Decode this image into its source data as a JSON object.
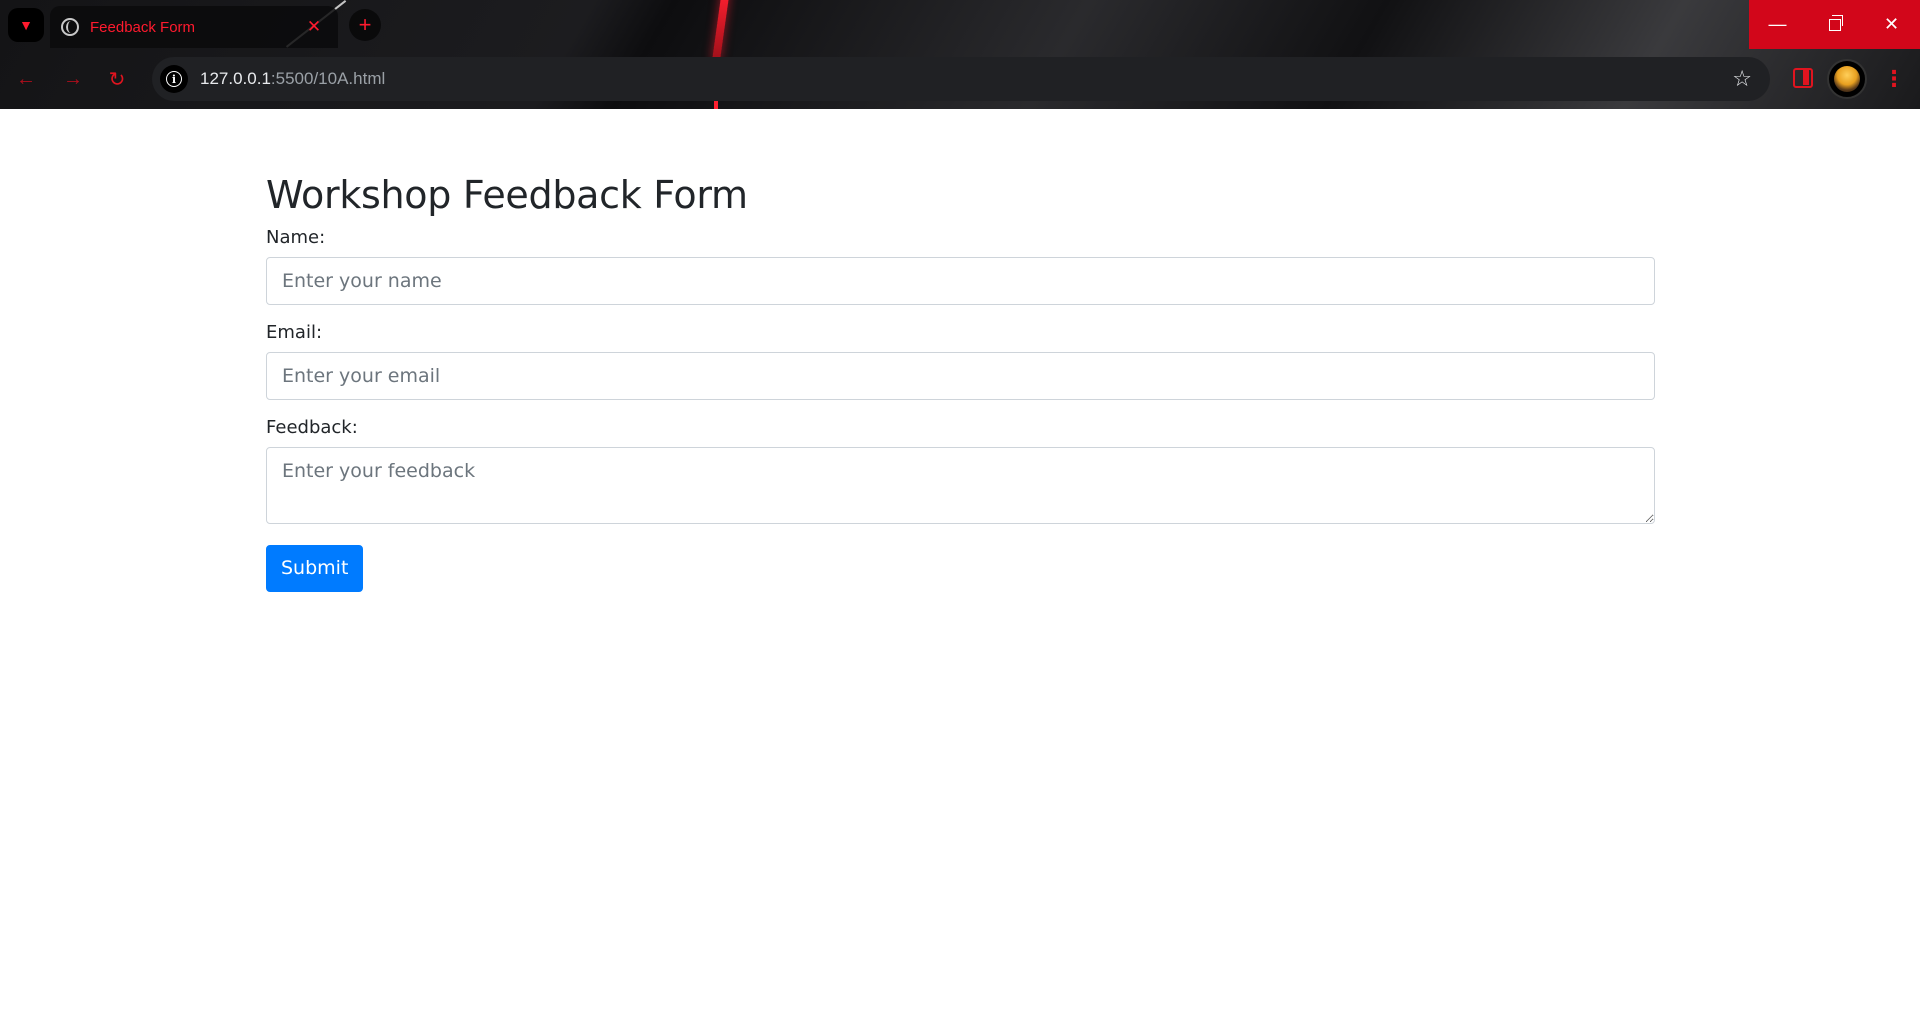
{
  "browser": {
    "tab_title": "Feedback Form",
    "new_tab_symbol": "+",
    "tab_close_symbol": "✕",
    "url_host": "127.0.0.1",
    "url_path": ":5500/10A.html",
    "window_controls": {
      "minimize_symbol": "—",
      "close_symbol": "✕"
    },
    "accent_color": "#e0141f",
    "window_control_color": "#d2061a"
  },
  "form": {
    "title": "Workshop Feedback Form",
    "name_label": "Name:",
    "name_placeholder": "Enter your name",
    "name_value": "",
    "email_label": "Email:",
    "email_placeholder": "Enter your email",
    "email_value": "",
    "feedback_label": "Feedback:",
    "feedback_placeholder": "Enter your feedback",
    "feedback_value": "",
    "submit_label": "Submit",
    "button_color": "#007bff"
  }
}
